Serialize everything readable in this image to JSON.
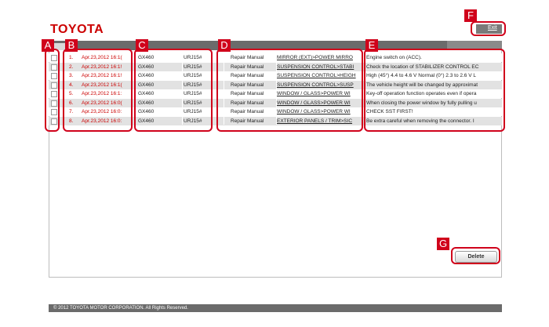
{
  "header": {
    "logo": "TOYOTA",
    "exit_label": "Exit"
  },
  "rows": [
    {
      "no": "1.",
      "date": "Apr.23,2012 16:1(",
      "model": "GX460",
      "code": "URJ15#",
      "type": "Repair Manual",
      "title": "MIRROR (EXT)>POWER MIRRO",
      "desc": "Engine switch on (ACC)."
    },
    {
      "no": "2.",
      "date": "Apr.23,2012 16:1!",
      "model": "GX460",
      "code": "URJ15#",
      "type": "Repair Manual",
      "title": "SUSPENSION CONTROL>STABI",
      "desc": "Check the location of STABILIZER CONTROL EC"
    },
    {
      "no": "3.",
      "date": "Apr.23,2012 16:1!",
      "model": "GX460",
      "code": "URJ15#",
      "type": "Repair Manual",
      "title": "SUSPENSION CONTROL>HEIGH",
      "desc": "High (45°) 4.4 to 4.6 V Normal (0°) 2.3 to 2.6 V L"
    },
    {
      "no": "4.",
      "date": "Apr.23,2012 16:1(",
      "model": "GX460",
      "code": "URJ15#",
      "type": "Repair Manual",
      "title": "SUSPENSION CONTROL>SUSP",
      "desc": "The vehicle height will be changed by approximat"
    },
    {
      "no": "5.",
      "date": "Apr.23,2012 16:1:",
      "model": "GX460",
      "code": "URJ15#",
      "type": "Repair Manual",
      "title": "WINDOW / GLASS>POWER WI",
      "desc": "Key-off operation function operates even if opera"
    },
    {
      "no": "6.",
      "date": "Apr.23,2012 16:0(",
      "model": "GX460",
      "code": "URJ15#",
      "type": "Repair Manual",
      "title": "WINDOW / GLASS>POWER WI",
      "desc": "When closing the power window by fully pulling u"
    },
    {
      "no": "7.",
      "date": "Apr.23,2012 16:0:",
      "model": "GX460",
      "code": "URJ15#",
      "type": "Repair Manual",
      "title": "WINDOW / GLASS>POWER WI",
      "desc": "CHECK SST FIRST!"
    },
    {
      "no": "8.",
      "date": "Apr.23,2012 16:0:",
      "model": "GX460",
      "code": "URJ15#",
      "type": "Repair Manual",
      "title": "EXTERIOR PANELS / TRIM>SIC",
      "desc": "Be extra careful when removing the connector. I"
    }
  ],
  "delete_label": "Delete",
  "footer": "© 2012 TOYOTA MOTOR CORPORATION. All Rights Reserved.",
  "callouts": {
    "a": "A",
    "b": "B",
    "c": "C",
    "d": "D",
    "e": "E",
    "f": "F",
    "g": "G"
  },
  "colors": {
    "brand": "#cc0000",
    "callout": "#d0021b",
    "bar": "#6b6b6b"
  }
}
